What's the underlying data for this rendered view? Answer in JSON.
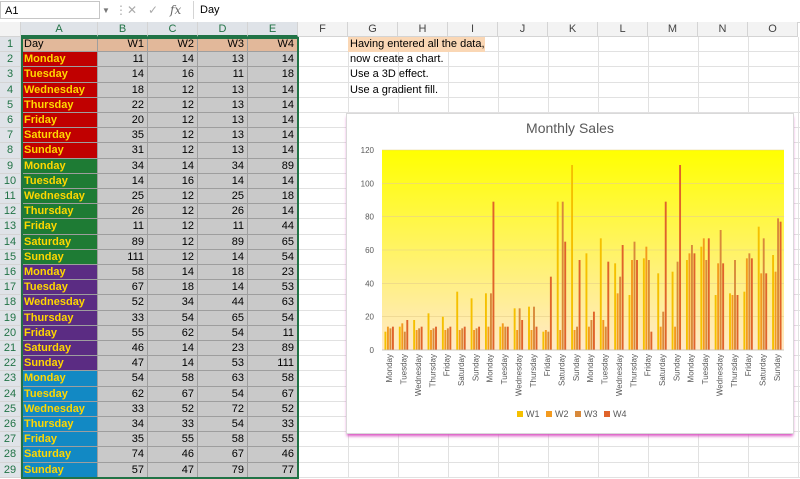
{
  "formula_bar": {
    "name_box": "A1",
    "formula": "Day",
    "cancel_icon": "✕",
    "enter_icon": "✓",
    "fx_icon": "fx"
  },
  "columns": [
    "A",
    "B",
    "C",
    "D",
    "E",
    "F",
    "G",
    "H",
    "I",
    "J",
    "K",
    "L",
    "M",
    "N",
    "O"
  ],
  "rows": [
    "1",
    "2",
    "3",
    "4",
    "5",
    "6",
    "7",
    "8",
    "9",
    "10",
    "11",
    "12",
    "13",
    "14",
    "15",
    "16",
    "17",
    "18",
    "19",
    "20",
    "21",
    "22",
    "23",
    "24",
    "25",
    "26",
    "27",
    "28",
    "29"
  ],
  "header_row": [
    "Day",
    "W1",
    "W2",
    "W3",
    "W4"
  ],
  "week_colors": [
    "#c00000",
    "#1e7b34",
    "#5b2c83",
    "#1289c4"
  ],
  "data": [
    [
      "Monday",
      11,
      14,
      13,
      14
    ],
    [
      "Tuesday",
      14,
      16,
      11,
      18
    ],
    [
      "Wednesday",
      18,
      12,
      13,
      14
    ],
    [
      "Thursday",
      22,
      12,
      13,
      14
    ],
    [
      "Friday",
      20,
      12,
      13,
      14
    ],
    [
      "Saturday",
      35,
      12,
      13,
      14
    ],
    [
      "Sunday",
      31,
      12,
      13,
      14
    ],
    [
      "Monday",
      34,
      14,
      34,
      89
    ],
    [
      "Tuesday",
      14,
      16,
      14,
      14
    ],
    [
      "Wednesday",
      25,
      12,
      25,
      18
    ],
    [
      "Thursday",
      26,
      12,
      26,
      14
    ],
    [
      "Friday",
      11,
      12,
      11,
      44
    ],
    [
      "Saturday",
      89,
      12,
      89,
      65
    ],
    [
      "Sunday",
      111,
      12,
      14,
      54
    ],
    [
      "Monday",
      58,
      14,
      18,
      23
    ],
    [
      "Tuesday",
      67,
      18,
      14,
      53
    ],
    [
      "Wednesday",
      52,
      34,
      44,
      63
    ],
    [
      "Thursday",
      33,
      54,
      65,
      54
    ],
    [
      "Friday",
      55,
      62,
      54,
      11
    ],
    [
      "Saturday",
      46,
      14,
      23,
      89
    ],
    [
      "Sunday",
      47,
      14,
      53,
      111
    ],
    [
      "Monday",
      54,
      58,
      63,
      58
    ],
    [
      "Tuesday",
      62,
      67,
      54,
      67
    ],
    [
      "Wednesday",
      33,
      52,
      72,
      52
    ],
    [
      "Thursday",
      34,
      33,
      54,
      33
    ],
    [
      "Friday",
      35,
      55,
      58,
      55
    ],
    [
      "Saturday",
      74,
      46,
      67,
      46
    ],
    [
      "Sunday",
      57,
      47,
      79,
      77
    ]
  ],
  "notes": [
    "Having entered all the data,",
    "now create a chart.",
    "Use a 3D effect.",
    "Use a gradient fill."
  ],
  "chart_data": {
    "type": "bar",
    "title": "Monthly Sales",
    "categories": [
      "Monday",
      "Tuesday",
      "Wednesday",
      "Thursday",
      "Friday",
      "Saturday",
      "Sunday",
      "Monday",
      "Tuesday",
      "Wednesday",
      "Thursday",
      "Friday",
      "Saturday",
      "Sunday",
      "Monday",
      "Tuesday",
      "Wednesday",
      "Thursday",
      "Friday",
      "Saturday",
      "Sunday",
      "Monday",
      "Tuesday",
      "Wednesday",
      "Thursday",
      "Friday",
      "Saturday",
      "Sunday"
    ],
    "series": [
      {
        "name": "W1",
        "color": "#f5c000",
        "values": [
          11,
          14,
          18,
          22,
          20,
          35,
          31,
          34,
          14,
          25,
          26,
          11,
          89,
          111,
          58,
          67,
          52,
          33,
          55,
          46,
          47,
          54,
          62,
          33,
          34,
          35,
          74,
          57
        ]
      },
      {
        "name": "W2",
        "color": "#f39a1e",
        "values": [
          14,
          16,
          12,
          12,
          12,
          12,
          12,
          14,
          16,
          12,
          12,
          12,
          12,
          12,
          14,
          18,
          34,
          54,
          62,
          14,
          14,
          58,
          67,
          52,
          33,
          55,
          46,
          47
        ]
      },
      {
        "name": "W3",
        "color": "#d8893a",
        "values": [
          13,
          11,
          13,
          13,
          13,
          13,
          13,
          34,
          14,
          25,
          26,
          11,
          89,
          14,
          18,
          14,
          44,
          65,
          54,
          23,
          53,
          63,
          54,
          72,
          54,
          58,
          67,
          79
        ]
      },
      {
        "name": "W4",
        "color": "#e0632a",
        "values": [
          14,
          18,
          14,
          14,
          14,
          14,
          14,
          89,
          14,
          18,
          14,
          44,
          65,
          54,
          23,
          53,
          63,
          54,
          11,
          89,
          111,
          58,
          67,
          52,
          33,
          55,
          46,
          77
        ]
      }
    ],
    "yticks": [
      "0",
      "20",
      "40",
      "60",
      "80",
      "100",
      "120"
    ],
    "ylim": [
      0,
      120
    ],
    "background_gradient": [
      "#ffff00",
      "#ffe8c8"
    ],
    "legend_position": "bottom",
    "grid": true
  }
}
